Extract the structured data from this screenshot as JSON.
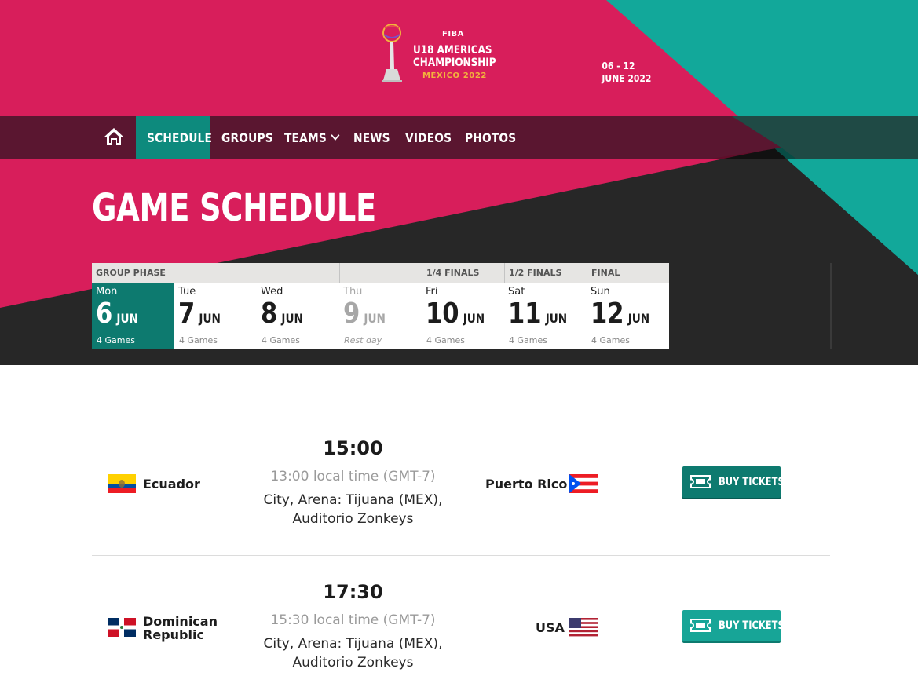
{
  "header": {
    "logo": {
      "org": "FIBA",
      "line1": "U18 AMERICAS",
      "line2": "CHAMPIONSHIP",
      "line3": "MÉXICO 2022"
    },
    "dates": {
      "line1": "06 - 12",
      "line2": "JUNE 2022"
    }
  },
  "nav": {
    "home_icon": "home-icon",
    "items": [
      {
        "label": "SCHEDULE",
        "active": true
      },
      {
        "label": "GROUPS"
      },
      {
        "label": "TEAMS",
        "has_dropdown": true
      },
      {
        "label": "NEWS"
      },
      {
        "label": "VIDEOS"
      },
      {
        "label": "PHOTOS"
      }
    ]
  },
  "page_title": "GAME SCHEDULE",
  "schedule": {
    "phases": [
      "GROUP PHASE",
      "1/4 FINALS",
      "1/2 FINALS",
      "FINAL"
    ],
    "days": [
      {
        "weekday": "Mon",
        "day": "6",
        "month": "JUN",
        "games": "4 Games",
        "active": true
      },
      {
        "weekday": "Tue",
        "day": "7",
        "month": "JUN",
        "games": "4 Games"
      },
      {
        "weekday": "Wed",
        "day": "8",
        "month": "JUN",
        "games": "4 Games"
      },
      {
        "weekday": "Thu",
        "day": "9",
        "month": "JUN",
        "games": "Rest day",
        "rest": true
      },
      {
        "weekday": "Fri",
        "day": "10",
        "month": "JUN",
        "games": "4 Games"
      },
      {
        "weekday": "Sat",
        "day": "11",
        "month": "JUN",
        "games": "4 Games"
      },
      {
        "weekday": "Sun",
        "day": "12",
        "month": "JUN",
        "games": "4 Games"
      }
    ]
  },
  "games": [
    {
      "time": "15:00",
      "local_time": "13:00 local time (GMT-7)",
      "venue_line1": "City, Arena: Tijuana (MEX),",
      "venue_line2": "Auditorio Zonkeys",
      "home_team": "Ecuador",
      "away_team": "Puerto Rico",
      "button": "BUY TICKETS"
    },
    {
      "time": "17:30",
      "local_time": "15:30 local time (GMT-7)",
      "venue_line1": "City, Arena: Tijuana (MEX),",
      "venue_line2": "Auditorio Zonkeys",
      "home_team_line1": "Dominican",
      "home_team_line2": "Republic",
      "away_team": "USA",
      "button": "BUY TICKETS"
    }
  ],
  "colors": {
    "pink": "#d81e5b",
    "teal": "#12a89a",
    "dark": "#272727",
    "button": "#0d7a6f"
  }
}
